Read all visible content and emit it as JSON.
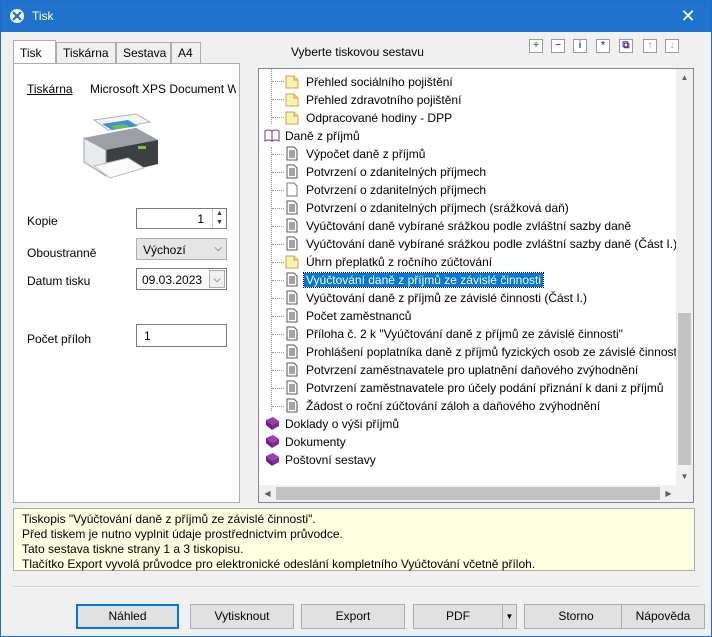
{
  "window": {
    "title": "Tisk",
    "close_glyph": "✕"
  },
  "tabs": [
    "Tisk",
    "Tiskárna",
    "Sestava",
    "A4"
  ],
  "left": {
    "printer_label": "Tiskárna",
    "printer_name": "Microsoft XPS Document W",
    "copies_label": "Kopie",
    "copies_value": "1",
    "duplex_label": "Oboustranně",
    "duplex_value": "Výchozí",
    "date_label": "Datum tisku",
    "date_value": "09.03.2023",
    "attachments_label": "Počet příloh",
    "attachments_value": "1"
  },
  "heading": "Vyberte tiskovou sestavu",
  "toolbar_icons": [
    "add-icon",
    "remove-icon",
    "info-icon",
    "star-icon",
    "copy-icon",
    "move-up-icon",
    "move-down-icon"
  ],
  "tree": [
    {
      "label": "Přehled sociálního pojištění",
      "icon": "folder-icon"
    },
    {
      "label": "Přehled zdravotního pojištění",
      "icon": "folder-icon"
    },
    {
      "label": "Odpracované hodiny - DPP",
      "icon": "folder-icon"
    },
    {
      "label": "Daně z příjmů",
      "icon": "book-open-icon"
    },
    {
      "label": "Výpočet daně z příjmů",
      "icon": "document-icon"
    },
    {
      "label": "Potvrzení o zdanitelných příjmech",
      "icon": "document-icon"
    },
    {
      "label": "Potvrzení o zdanitelných příjmech",
      "icon": "blank-document-icon"
    },
    {
      "label": "Potvrzení o zdanitelných příjmech (srážková daň)",
      "icon": "document-icon"
    },
    {
      "label": "Vyúčtování daně vybírané srážkou podle zvláštní sazby daně",
      "icon": "document-icon"
    },
    {
      "label": "Vyúčtování daně vybírané srážkou podle zvláštní sazby daně (Část I.)",
      "icon": "document-icon"
    },
    {
      "label": "Úhrn přeplatků z ročního zúčtování",
      "icon": "folder-icon"
    },
    {
      "label": "Vyúčtování daně z příjmů ze závislé činnosti",
      "icon": "document-icon",
      "selected": true
    },
    {
      "label": "Vyúčtování daně z příjmů ze závislé činnosti (Část I.)",
      "icon": "document-icon"
    },
    {
      "label": "Počet zaměstnanců",
      "icon": "document-icon"
    },
    {
      "label": "Příloha č. 2 k \"Vyúčtování daně z příjmů ze závislé činnosti\"",
      "icon": "document-icon"
    },
    {
      "label": "Prohlášení poplatníka daně z příjmů fyzických osob ze závislé činnosti",
      "icon": "document-icon"
    },
    {
      "label": "Potvrzení zaměstnavatele pro uplatnění daňového zvýhodnění",
      "icon": "document-icon"
    },
    {
      "label": "Potvrzení zaměstnavatele pro účely podání přiznání k dani z příjmů",
      "icon": "document-icon"
    },
    {
      "label": "Žádost o roční zúčtování záloh a daňového zvýhodnění",
      "icon": "document-icon"
    },
    {
      "label": "Doklady o výši příjmů",
      "icon": "book-closed-icon"
    },
    {
      "label": "Dokumenty",
      "icon": "book-closed-icon"
    },
    {
      "label": "Poštovní sestavy",
      "icon": "book-closed-icon"
    }
  ],
  "info_lines": [
    "Tiskopis \"Vyúčtování daně z příjmů ze závislé činnosti\".",
    "Před tiskem je nutno vyplnit údaje prostřednictvím průvodce.",
    "Tato sestava tiskne strany 1 a 3 tiskopisu.",
    "Tlačítko Export vyvolá průvodce pro elektronické odeslání kompletního Vyúčtování včetně příloh."
  ],
  "buttons": {
    "preview": "Náhled",
    "print": "Vytisknout",
    "export": "Export",
    "pdf": "PDF",
    "cancel": "Storno",
    "help": "Nápověda"
  },
  "colors": {
    "titlebar": "#1f73cc",
    "selection": "#0078d7",
    "info_bg": "#ffffe1"
  }
}
